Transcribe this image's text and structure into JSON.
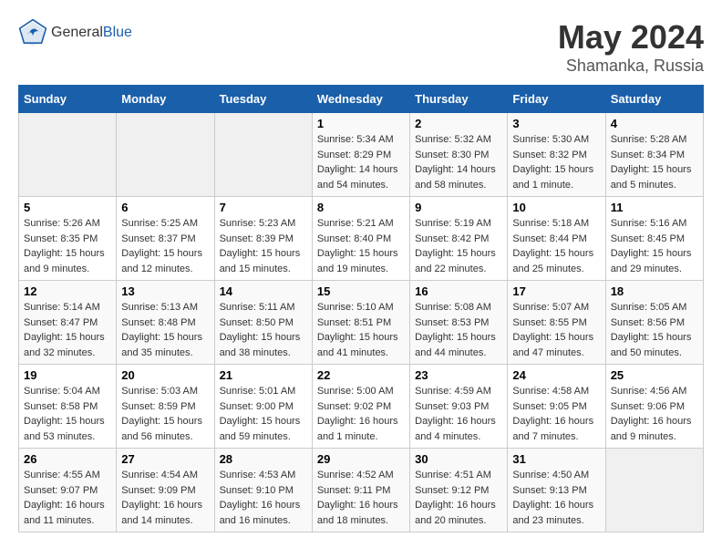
{
  "header": {
    "logo_general": "General",
    "logo_blue": "Blue",
    "title": "May 2024",
    "subtitle": "Shamanka, Russia"
  },
  "days_of_week": [
    "Sunday",
    "Monday",
    "Tuesday",
    "Wednesday",
    "Thursday",
    "Friday",
    "Saturday"
  ],
  "weeks": [
    [
      {
        "day": "",
        "sunrise": "",
        "sunset": "",
        "daylight": ""
      },
      {
        "day": "",
        "sunrise": "",
        "sunset": "",
        "daylight": ""
      },
      {
        "day": "",
        "sunrise": "",
        "sunset": "",
        "daylight": ""
      },
      {
        "day": "1",
        "sunrise": "Sunrise: 5:34 AM",
        "sunset": "Sunset: 8:29 PM",
        "daylight": "Daylight: 14 hours and 54 minutes."
      },
      {
        "day": "2",
        "sunrise": "Sunrise: 5:32 AM",
        "sunset": "Sunset: 8:30 PM",
        "daylight": "Daylight: 14 hours and 58 minutes."
      },
      {
        "day": "3",
        "sunrise": "Sunrise: 5:30 AM",
        "sunset": "Sunset: 8:32 PM",
        "daylight": "Daylight: 15 hours and 1 minute."
      },
      {
        "day": "4",
        "sunrise": "Sunrise: 5:28 AM",
        "sunset": "Sunset: 8:34 PM",
        "daylight": "Daylight: 15 hours and 5 minutes."
      }
    ],
    [
      {
        "day": "5",
        "sunrise": "Sunrise: 5:26 AM",
        "sunset": "Sunset: 8:35 PM",
        "daylight": "Daylight: 15 hours and 9 minutes."
      },
      {
        "day": "6",
        "sunrise": "Sunrise: 5:25 AM",
        "sunset": "Sunset: 8:37 PM",
        "daylight": "Daylight: 15 hours and 12 minutes."
      },
      {
        "day": "7",
        "sunrise": "Sunrise: 5:23 AM",
        "sunset": "Sunset: 8:39 PM",
        "daylight": "Daylight: 15 hours and 15 minutes."
      },
      {
        "day": "8",
        "sunrise": "Sunrise: 5:21 AM",
        "sunset": "Sunset: 8:40 PM",
        "daylight": "Daylight: 15 hours and 19 minutes."
      },
      {
        "day": "9",
        "sunrise": "Sunrise: 5:19 AM",
        "sunset": "Sunset: 8:42 PM",
        "daylight": "Daylight: 15 hours and 22 minutes."
      },
      {
        "day": "10",
        "sunrise": "Sunrise: 5:18 AM",
        "sunset": "Sunset: 8:44 PM",
        "daylight": "Daylight: 15 hours and 25 minutes."
      },
      {
        "day": "11",
        "sunrise": "Sunrise: 5:16 AM",
        "sunset": "Sunset: 8:45 PM",
        "daylight": "Daylight: 15 hours and 29 minutes."
      }
    ],
    [
      {
        "day": "12",
        "sunrise": "Sunrise: 5:14 AM",
        "sunset": "Sunset: 8:47 PM",
        "daylight": "Daylight: 15 hours and 32 minutes."
      },
      {
        "day": "13",
        "sunrise": "Sunrise: 5:13 AM",
        "sunset": "Sunset: 8:48 PM",
        "daylight": "Daylight: 15 hours and 35 minutes."
      },
      {
        "day": "14",
        "sunrise": "Sunrise: 5:11 AM",
        "sunset": "Sunset: 8:50 PM",
        "daylight": "Daylight: 15 hours and 38 minutes."
      },
      {
        "day": "15",
        "sunrise": "Sunrise: 5:10 AM",
        "sunset": "Sunset: 8:51 PM",
        "daylight": "Daylight: 15 hours and 41 minutes."
      },
      {
        "day": "16",
        "sunrise": "Sunrise: 5:08 AM",
        "sunset": "Sunset: 8:53 PM",
        "daylight": "Daylight: 15 hours and 44 minutes."
      },
      {
        "day": "17",
        "sunrise": "Sunrise: 5:07 AM",
        "sunset": "Sunset: 8:55 PM",
        "daylight": "Daylight: 15 hours and 47 minutes."
      },
      {
        "day": "18",
        "sunrise": "Sunrise: 5:05 AM",
        "sunset": "Sunset: 8:56 PM",
        "daylight": "Daylight: 15 hours and 50 minutes."
      }
    ],
    [
      {
        "day": "19",
        "sunrise": "Sunrise: 5:04 AM",
        "sunset": "Sunset: 8:58 PM",
        "daylight": "Daylight: 15 hours and 53 minutes."
      },
      {
        "day": "20",
        "sunrise": "Sunrise: 5:03 AM",
        "sunset": "Sunset: 8:59 PM",
        "daylight": "Daylight: 15 hours and 56 minutes."
      },
      {
        "day": "21",
        "sunrise": "Sunrise: 5:01 AM",
        "sunset": "Sunset: 9:00 PM",
        "daylight": "Daylight: 15 hours and 59 minutes."
      },
      {
        "day": "22",
        "sunrise": "Sunrise: 5:00 AM",
        "sunset": "Sunset: 9:02 PM",
        "daylight": "Daylight: 16 hours and 1 minute."
      },
      {
        "day": "23",
        "sunrise": "Sunrise: 4:59 AM",
        "sunset": "Sunset: 9:03 PM",
        "daylight": "Daylight: 16 hours and 4 minutes."
      },
      {
        "day": "24",
        "sunrise": "Sunrise: 4:58 AM",
        "sunset": "Sunset: 9:05 PM",
        "daylight": "Daylight: 16 hours and 7 minutes."
      },
      {
        "day": "25",
        "sunrise": "Sunrise: 4:56 AM",
        "sunset": "Sunset: 9:06 PM",
        "daylight": "Daylight: 16 hours and 9 minutes."
      }
    ],
    [
      {
        "day": "26",
        "sunrise": "Sunrise: 4:55 AM",
        "sunset": "Sunset: 9:07 PM",
        "daylight": "Daylight: 16 hours and 11 minutes."
      },
      {
        "day": "27",
        "sunrise": "Sunrise: 4:54 AM",
        "sunset": "Sunset: 9:09 PM",
        "daylight": "Daylight: 16 hours and 14 minutes."
      },
      {
        "day": "28",
        "sunrise": "Sunrise: 4:53 AM",
        "sunset": "Sunset: 9:10 PM",
        "daylight": "Daylight: 16 hours and 16 minutes."
      },
      {
        "day": "29",
        "sunrise": "Sunrise: 4:52 AM",
        "sunset": "Sunset: 9:11 PM",
        "daylight": "Daylight: 16 hours and 18 minutes."
      },
      {
        "day": "30",
        "sunrise": "Sunrise: 4:51 AM",
        "sunset": "Sunset: 9:12 PM",
        "daylight": "Daylight: 16 hours and 20 minutes."
      },
      {
        "day": "31",
        "sunrise": "Sunrise: 4:50 AM",
        "sunset": "Sunset: 9:13 PM",
        "daylight": "Daylight: 16 hours and 23 minutes."
      },
      {
        "day": "",
        "sunrise": "",
        "sunset": "",
        "daylight": ""
      }
    ]
  ]
}
